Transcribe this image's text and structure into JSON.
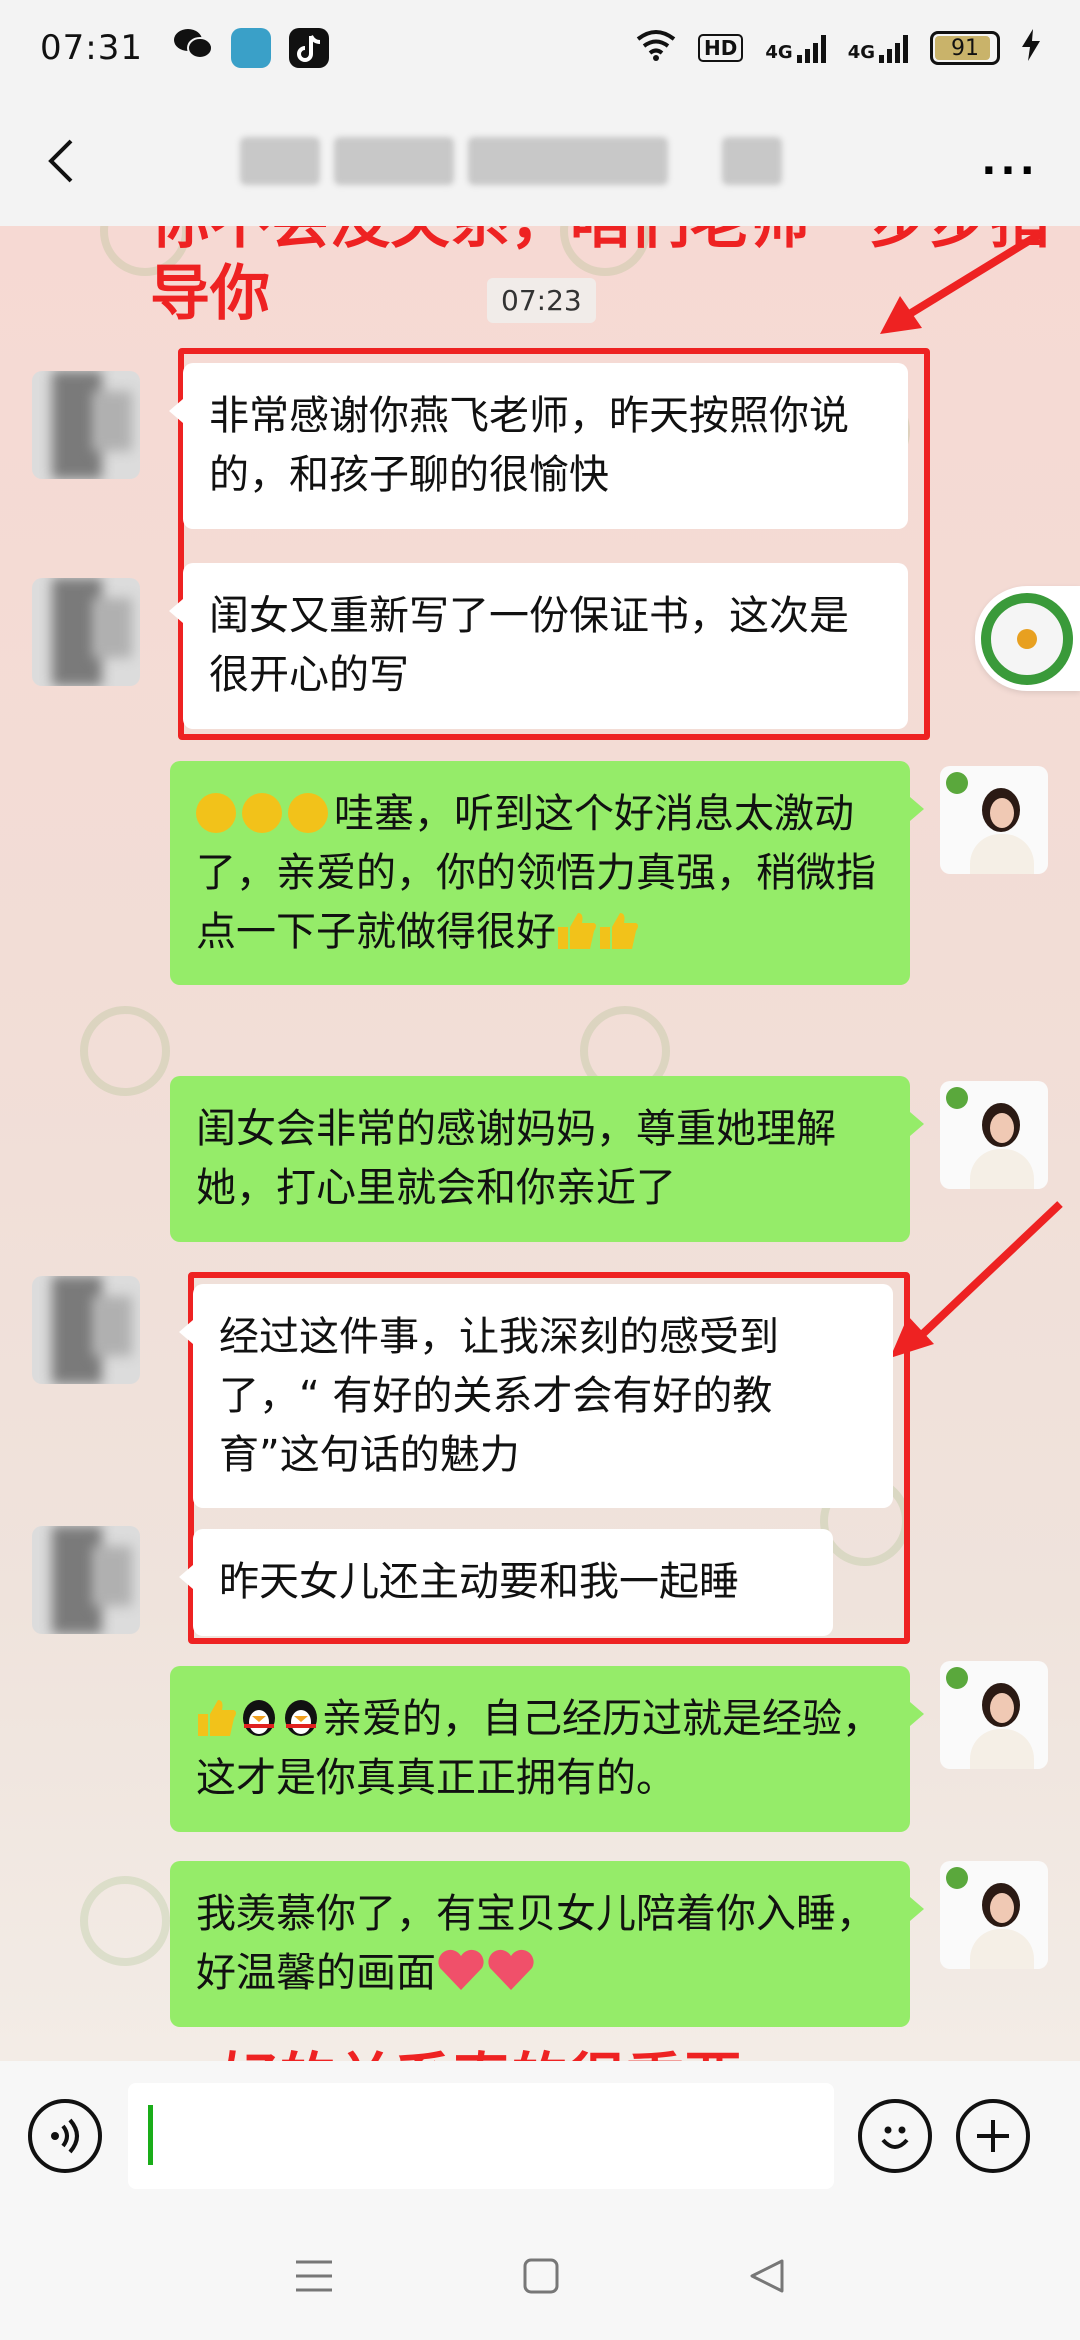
{
  "status_bar": {
    "time": "07:31",
    "network_badge": "HD",
    "sim1": "4G",
    "sim2": "4G",
    "battery": "91",
    "battery_level": 0.91
  },
  "nav": {
    "back_icon": "chevron-left-icon",
    "more_label": "..."
  },
  "annotations": {
    "top": "你不会没关系，咱们老师一步步指导你",
    "bottom": "好的关系真的很重要"
  },
  "chat": {
    "timestamp": "07:23",
    "messages": [
      {
        "side": "in",
        "text": "非常感谢你燕飞老师，昨天按照你说的，和孩子聊的很愉快"
      },
      {
        "side": "in",
        "text": "闺女又重新写了一份保证书，这次是很开心的写"
      },
      {
        "side": "out",
        "text": "哇塞，听到这个好消息太激动了，亲爱的，你的领悟力真强，稍微指点一下子就做得很好"
      },
      {
        "side": "out",
        "text": "闺女会非常的感谢妈妈，尊重她理解她，打心里就会和你亲近了"
      },
      {
        "side": "in",
        "text": "经过这件事，让我深刻的感受到了，“ 有好的关系才会有好的教育”这句话的魅力"
      },
      {
        "side": "in",
        "text": "昨天女儿还主动要和我一起睡"
      },
      {
        "side": "out",
        "text": "亲爱的，自己经历过就是经验，这才是你真真正正拥有的。"
      },
      {
        "side": "out",
        "text": "我羡慕你了，有宝贝女儿陪着你入睡，好温馨的画面"
      }
    ]
  },
  "input_bar": {
    "voice_icon": "voice-icon",
    "emoji_icon": "emoji-icon",
    "add_icon": "plus-icon"
  },
  "colors": {
    "incoming_bubble": "#ffffff",
    "outgoing_bubble": "#95ec69",
    "annotation": "#ee2222"
  }
}
